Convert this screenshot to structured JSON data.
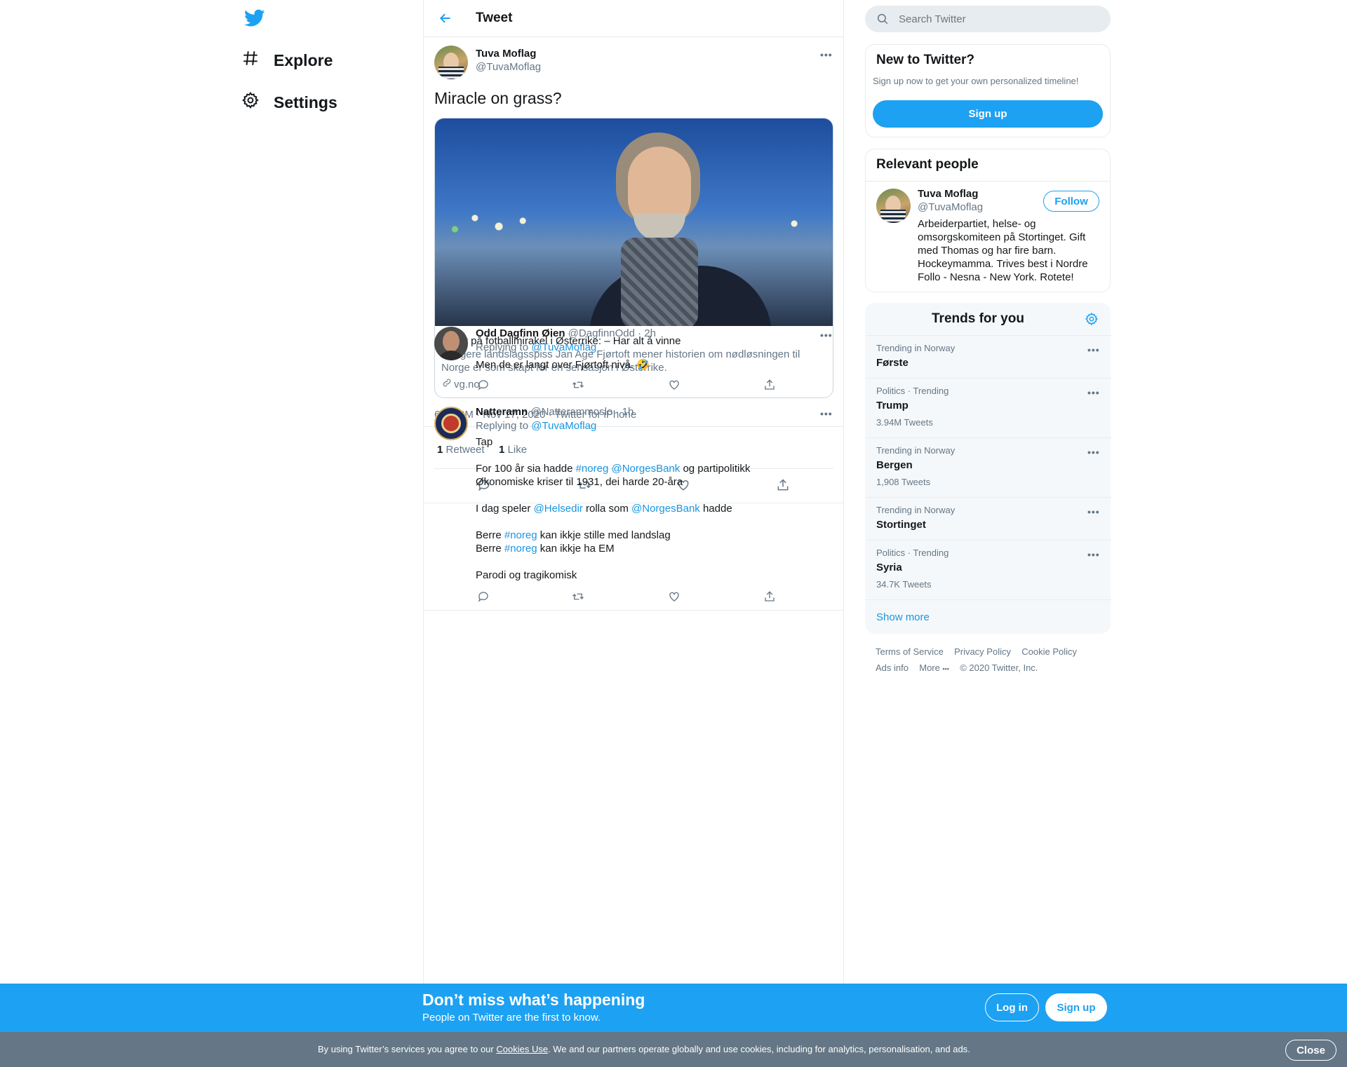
{
  "nav": {
    "items": [
      {
        "label": "Explore",
        "icon": "hashtag-icon"
      },
      {
        "label": "Settings",
        "icon": "gear-icon"
      }
    ]
  },
  "header": {
    "title": "Tweet"
  },
  "main_tweet": {
    "author_name": "Tuva Moflag",
    "author_handle": "@TuvaMoflag",
    "text": "Miracle on grass?",
    "card": {
      "title_fragment": "ft tror på fotballmirakel i Østerrike: – Har alt å vinne",
      "desc_line1": "Tidligere landslagsspiss Jan Age Fjørtoft mener historien om nødløsningen til",
      "desc_line2": "Norge er som skapt for en sensasjon i Østerrike.",
      "domain": "vg.no"
    },
    "timestamp": "6:50 PM · Nov 17, 2020 · Twitter for iPhone",
    "retweets_count": "1",
    "retweets_label": "Retweet",
    "likes_count": "1",
    "likes_label": "Like"
  },
  "replies": [
    {
      "author_name": "Odd Dagfinn Øien",
      "author_handle": "@DagfinnOdd",
      "time": "· 2h",
      "replying_prefix": "Replying to",
      "replying_to": "@TuvaMoflag",
      "text": "Men de er langt over Fjørtoft nivå. 🤣"
    },
    {
      "author_name": "Natteramn",
      "author_handle": "@Natterammoslo",
      "time": "· 1h",
      "replying_prefix": "Replying to",
      "replying_to": "@TuvaMoflag",
      "line1": "Tap",
      "line2a": "For 100 år sia hadde",
      "line2b": "#noreg",
      "line2c": "@NorgesBank",
      "line2d": "og partipolitikk",
      "line3": "Økonomiske kriser til 1931, dei harde 20-åra",
      "line4a": "I dag speler",
      "line4b": "@Helsedir",
      "line4c": "rolla som",
      "line4d": "@NorgesBank",
      "line4e": "hadde",
      "line5a": "Berre",
      "line5b": "#noreg",
      "line5c": "kan ikkje stille med landslag",
      "line6a": "Berre",
      "line6b": "#noreg",
      "line6c": "kan ikkje ha EM",
      "line7": "Parodi og tragikomisk"
    }
  ],
  "search": {
    "placeholder": "Search Twitter"
  },
  "new_to_twitter": {
    "title": "New to Twitter?",
    "subtitle": "Sign up now to get your own personalized timeline!",
    "button": "Sign up"
  },
  "relevant_people": {
    "title": "Relevant people",
    "name": "Tuva Moflag",
    "handle": "@TuvaMoflag",
    "follow": "Follow",
    "bio1": "Arbeiderpartiet, helse- og",
    "bio2": "omsorgskomiteen på Stortinget. Gift",
    "bio3": "med Thomas og har fire barn.",
    "bio4": "Hockeymamma. Trives best i Nordre",
    "bio5": "Follo - Nesna - New York. Rotete!"
  },
  "trends": {
    "title": "Trends for you",
    "items": [
      {
        "context": "Trending in Norway",
        "name": "Første",
        "count": ""
      },
      {
        "context": "Politics · Trending",
        "name": "Trump",
        "count": "3.94M Tweets"
      },
      {
        "context": "Trending in Norway",
        "name": "Bergen",
        "count": "1,908 Tweets"
      },
      {
        "context": "Trending in Norway",
        "name": "Stortinget",
        "count": ""
      },
      {
        "context": "Politics · Trending",
        "name": "Syria",
        "count": "34.7K Tweets"
      }
    ],
    "show_more": "Show more"
  },
  "footer": {
    "terms": "Terms of Service",
    "privacy": "Privacy Policy",
    "cookie": "Cookie Policy",
    "ads": "Ads info",
    "more": "More",
    "copyright": "© 2020 Twitter, Inc."
  },
  "signup_bar": {
    "title": "Don’t miss what’s happening",
    "subtitle": "People on Twitter are the first to know.",
    "login": "Log in",
    "signup": "Sign up"
  },
  "cookie_bar": {
    "text_before": "By using Twitter’s services you agree to our",
    "link": "Cookies Use",
    "text_after": ". We and our partners operate globally and use cookies, including for analytics, personalisation, and ads.",
    "close": "Close"
  },
  "colors": {
    "accent": "#1da1f2",
    "link": "#1b95e0",
    "secondary": "#657786"
  }
}
